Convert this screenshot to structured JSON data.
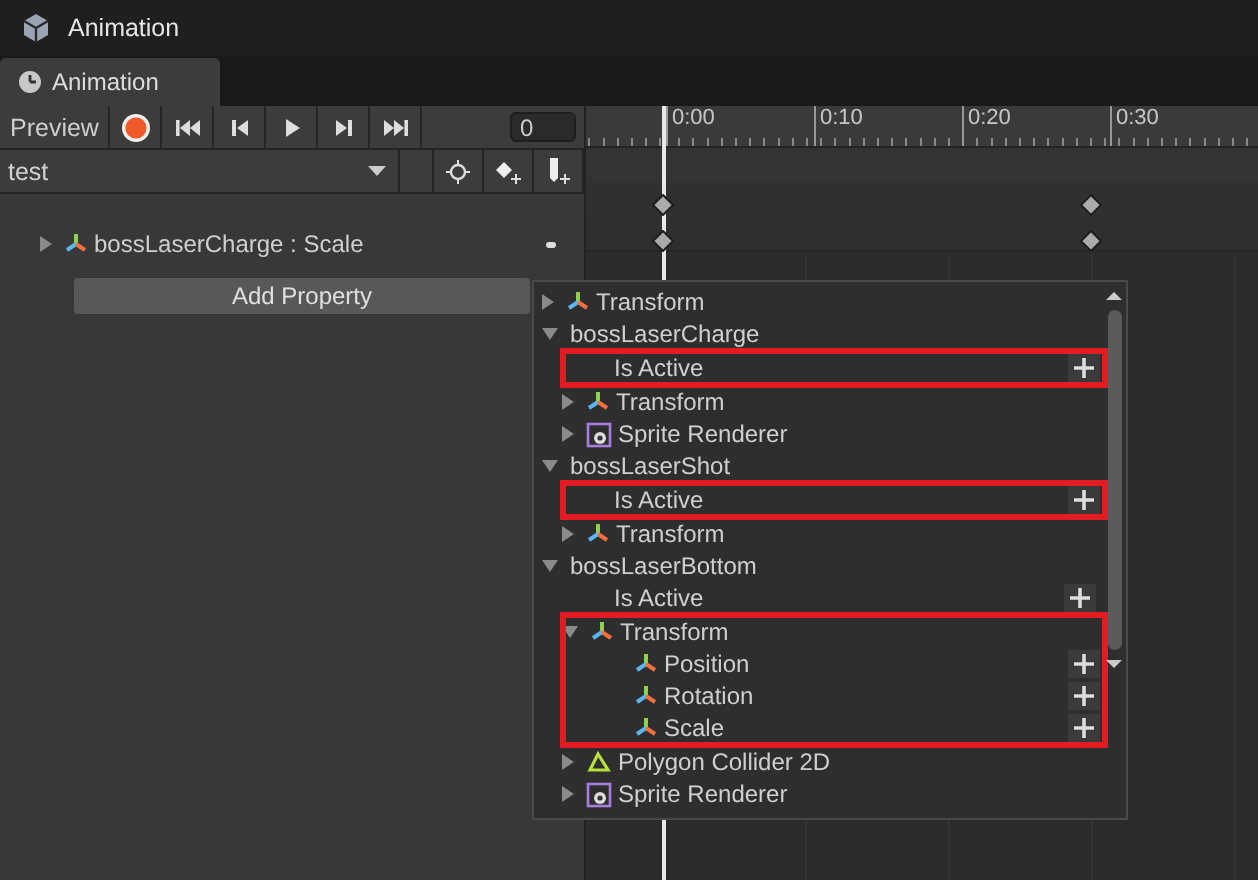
{
  "window": {
    "title": "Animation"
  },
  "tab": {
    "label": "Animation"
  },
  "toolbar": {
    "preview": "Preview",
    "frame": "0",
    "clip": "test"
  },
  "tracks": [
    {
      "label": "bossLaserCharge : Scale"
    }
  ],
  "add_property": "Add Property",
  "timeline": {
    "labels": [
      "0:00",
      "0:10",
      "0:20",
      "0:30"
    ]
  },
  "popup": {
    "items": [
      {
        "kind": "transform",
        "label": "Transform",
        "expanded": false
      },
      {
        "kind": "object",
        "label": "bossLaserCharge",
        "expanded": true,
        "children": [
          {
            "kind": "property",
            "label": "Is Active",
            "highlighted": true
          },
          {
            "kind": "transform",
            "label": "Transform",
            "expanded": false
          },
          {
            "kind": "sprite",
            "label": "Sprite Renderer",
            "expanded": false
          }
        ]
      },
      {
        "kind": "object",
        "label": "bossLaserShot",
        "expanded": true,
        "children": [
          {
            "kind": "property",
            "label": "Is Active",
            "highlighted": true
          },
          {
            "kind": "transform",
            "label": "Transform",
            "expanded": false
          }
        ]
      },
      {
        "kind": "object",
        "label": "bossLaserBottom",
        "expanded": true,
        "children": [
          {
            "kind": "property",
            "label": "Is Active",
            "highlighted": false
          },
          {
            "kind": "transform",
            "label": "Transform",
            "expanded": true,
            "highlighted": true,
            "children": [
              {
                "kind": "transform-property",
                "label": "Position"
              },
              {
                "kind": "transform-property",
                "label": "Rotation"
              },
              {
                "kind": "transform-property",
                "label": "Scale"
              }
            ]
          },
          {
            "kind": "collider",
            "label": "Polygon Collider 2D",
            "expanded": false
          },
          {
            "kind": "sprite",
            "label": "Sprite Renderer",
            "expanded": false
          }
        ]
      }
    ]
  }
}
